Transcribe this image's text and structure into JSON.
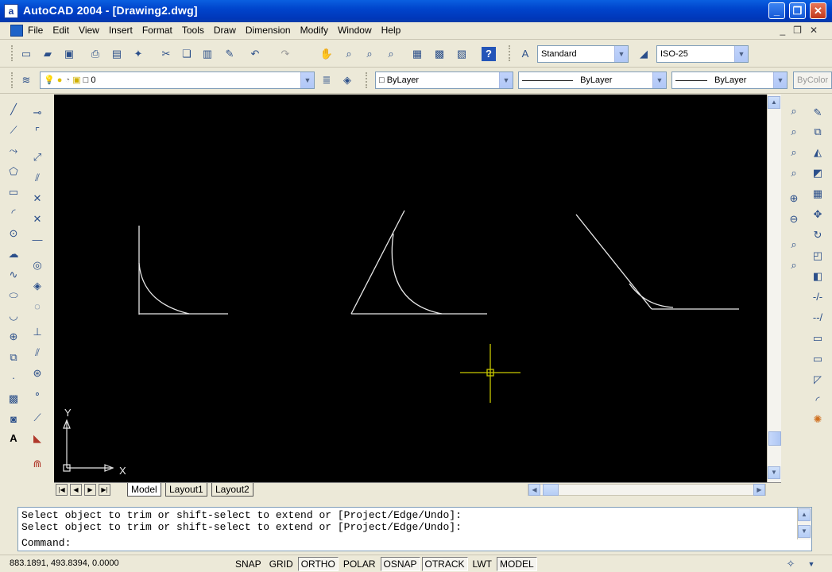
{
  "window": {
    "title": "AutoCAD 2004 - [Drawing2.dwg]",
    "app_icon": "a",
    "minimize": "_",
    "restore": "❐",
    "close": "✕"
  },
  "menu": {
    "items": [
      "File",
      "Edit",
      "View",
      "Insert",
      "Format",
      "Tools",
      "Draw",
      "Dimension",
      "Modify",
      "Window",
      "Help"
    ],
    "mdi": {
      "minimize": "_",
      "restore": "❐",
      "close": "✕"
    }
  },
  "toolbar": {
    "text_style": "Standard",
    "dim_style": "ISO-25",
    "layer": "0",
    "color": "ByLayer",
    "linetype": "ByLayer",
    "lineweight": "ByLayer",
    "plot_style": "ByColor"
  },
  "canvas": {
    "ucs_x": "X",
    "ucs_y": "Y",
    "background": "#000000",
    "geometry_color": "#e8e8e8",
    "crosshair_color": "#c8c800"
  },
  "tabs": {
    "model": "Model",
    "layout1": "Layout1",
    "layout2": "Layout2"
  },
  "command": {
    "history": [
      "Select object to trim or shift-select to extend or [Project/Edge/Undo]:",
      "Select object to trim or shift-select to extend or [Project/Edge/Undo]:"
    ],
    "prompt": "Command:"
  },
  "status": {
    "coords": "883.1891, 493.8394, 0.0000",
    "buttons": [
      {
        "label": "SNAP",
        "on": false
      },
      {
        "label": "GRID",
        "on": false
      },
      {
        "label": "ORTHO",
        "on": true
      },
      {
        "label": "POLAR",
        "on": false
      },
      {
        "label": "OSNAP",
        "on": true
      },
      {
        "label": "OTRACK",
        "on": true
      },
      {
        "label": "LWT",
        "on": false
      },
      {
        "label": "MODEL",
        "on": true
      }
    ]
  }
}
